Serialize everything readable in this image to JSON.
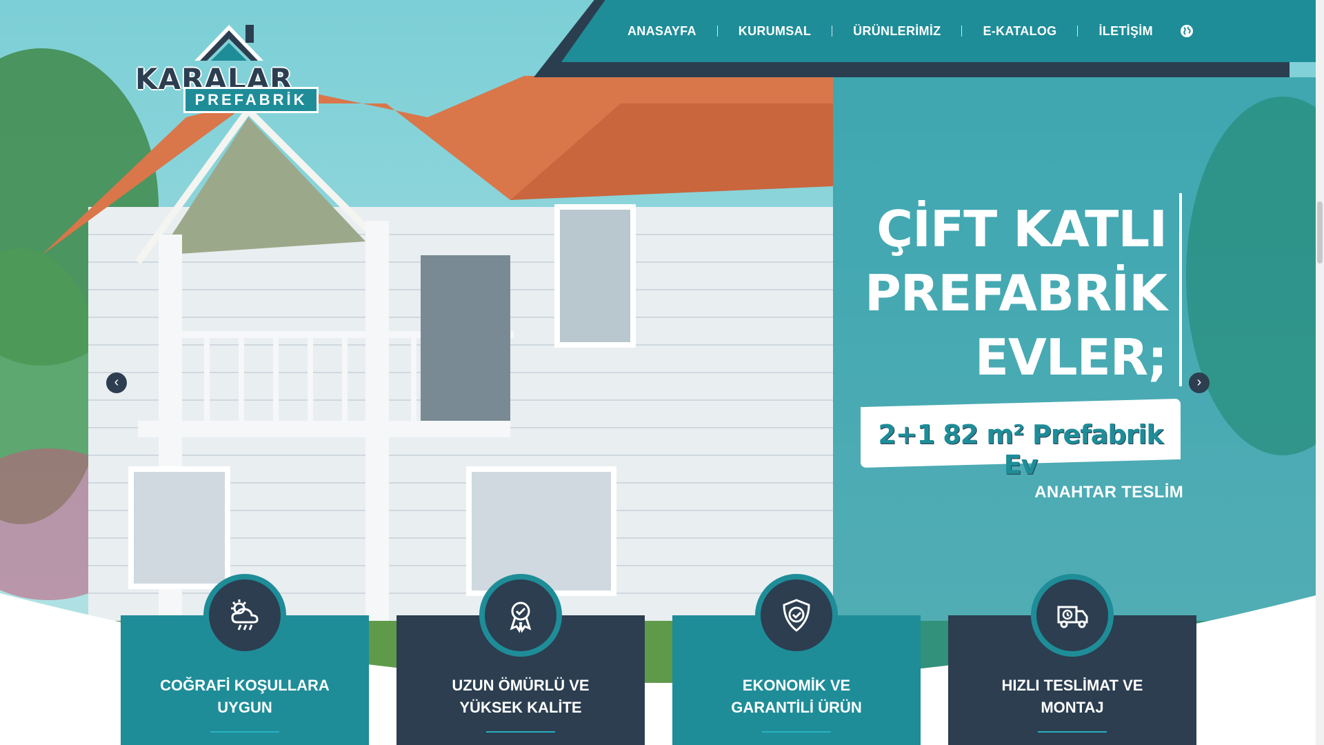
{
  "brand": {
    "name": "KARALAR",
    "sub": "PREFABRİK"
  },
  "nav": {
    "items": [
      {
        "label": "ANASAYFA"
      },
      {
        "label": "KURUMSAL"
      },
      {
        "label": "ÜRÜNLERİMİZ"
      },
      {
        "label": "E-KATALOG"
      },
      {
        "label": "İLETİŞİM"
      }
    ],
    "language_icon": "globe-icon"
  },
  "hero": {
    "title_line1": "ÇİFT KATLI",
    "title_line2": "PREFABRİK",
    "title_line3": "EVLER;",
    "badge": "2+1 82 m² Prefabrik Ev",
    "subtitle": "ANAHTAR TESLİM",
    "prev_arrow": "‹",
    "next_arrow": "›"
  },
  "features": [
    {
      "label_line1": "COĞRAFİ KOŞULLARA",
      "label_line2": "UYGUN",
      "icon": "weather-icon"
    },
    {
      "label_line1": "UZUN ÖMÜRLÜ VE",
      "label_line2": "YÜKSEK KALİTE",
      "icon": "award-ribbon-icon"
    },
    {
      "label_line1": "EKONOMİK VE",
      "label_line2": "GARANTİLİ ÜRÜN",
      "icon": "shield-check-icon"
    },
    {
      "label_line1": "HIZLI TESLİMAT VE",
      "label_line2": "MONTAJ",
      "icon": "delivery-truck-icon"
    }
  ],
  "colors": {
    "teal": "#1e8d98",
    "dark": "#2c3e50",
    "roof": "#d9764a"
  }
}
